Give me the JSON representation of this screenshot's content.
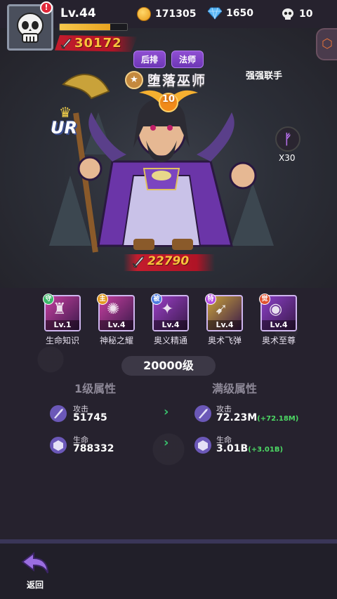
{
  "player": {
    "level": "Lv.44",
    "exp_progress": 0.75,
    "power": "30172",
    "alert": "!"
  },
  "currencies": {
    "gold": "171305",
    "gems": "1650",
    "skulls": "10"
  },
  "hero": {
    "tags": [
      "后排",
      "法师"
    ],
    "name": "堕落巫师",
    "subtitle": "强强联手",
    "stars": "10",
    "rarity": "UR",
    "power": "22790",
    "token_count": "X30"
  },
  "skills": [
    {
      "name": "生命知识",
      "level": "Lv.1",
      "kind": "守",
      "color": "#c63fa0",
      "kind_color": "#3db86a"
    },
    {
      "name": "神秘之耀",
      "level": "Lv.4",
      "kind": "主",
      "color": "#c63fa0",
      "kind_color": "#e29a23"
    },
    {
      "name": "奥义精通",
      "level": "Lv.4",
      "kind": "被",
      "color": "#9a3fc6",
      "kind_color": "#4d7be0"
    },
    {
      "name": "奥术飞弹",
      "level": "Lv.4",
      "kind": "特",
      "color": "#c9a23a",
      "kind_color": "#b34ee0"
    },
    {
      "name": "奥术至尊",
      "level": "Lv.4",
      "kind": "觉",
      "color": "#8a3fc6",
      "kind_color": "#e05230"
    }
  ],
  "level_banner": "20000级",
  "columns": {
    "left": "1级属性",
    "right": "满级属性"
  },
  "stats": {
    "attack_label": "攻击",
    "hp_label": "生命",
    "base_attack": "51745",
    "base_hp": "788332",
    "max_attack": "72.23M",
    "max_attack_gain": "(+72.18M)",
    "max_hp": "3.01B",
    "max_hp_gain": "(+3.01B)"
  },
  "nav": {
    "back": "返回"
  }
}
